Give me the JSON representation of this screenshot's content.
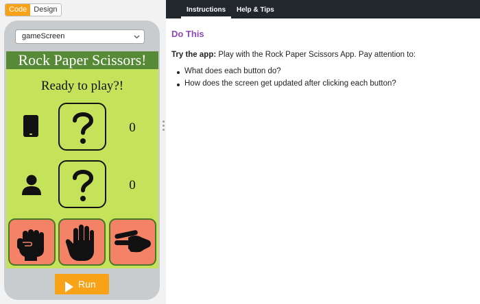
{
  "mode_toggle": {
    "code_label": "Code",
    "design_label": "Design",
    "active": "Code"
  },
  "app": {
    "screen_select": {
      "value": "gameScreen"
    },
    "title": "Rock Paper Scissors!",
    "ready_label": "Ready to play?!",
    "computer": {
      "icon": "phone-icon",
      "choice_icon": "question-mark-icon",
      "score": "0"
    },
    "player": {
      "icon": "person-icon",
      "choice_icon": "question-mark-icon",
      "score": "0"
    },
    "moves": [
      {
        "name": "rock",
        "icon": "fist-icon"
      },
      {
        "name": "paper",
        "icon": "open-hand-icon"
      },
      {
        "name": "scissors",
        "icon": "scissors-hand-icon"
      }
    ],
    "run_button": {
      "label": "Run"
    }
  },
  "instructions": {
    "tabs": [
      {
        "label": "Instructions",
        "active": true
      },
      {
        "label": "Help & Tips",
        "active": false
      }
    ],
    "heading": "Do This",
    "try_label": "Try the app:",
    "try_text": " Play with the Rock Paper Scissors App. Pay attention to:",
    "bullets": [
      "What does each button do?",
      "How does the screen get updated after clicking each button?"
    ]
  },
  "colors": {
    "accent_orange": "#f8a218",
    "app_background": "#c5e35a",
    "title_bar": "#578a37",
    "move_button": "#f48267",
    "heading_purple": "#8e47ba",
    "tab_bar": "#22272d"
  }
}
